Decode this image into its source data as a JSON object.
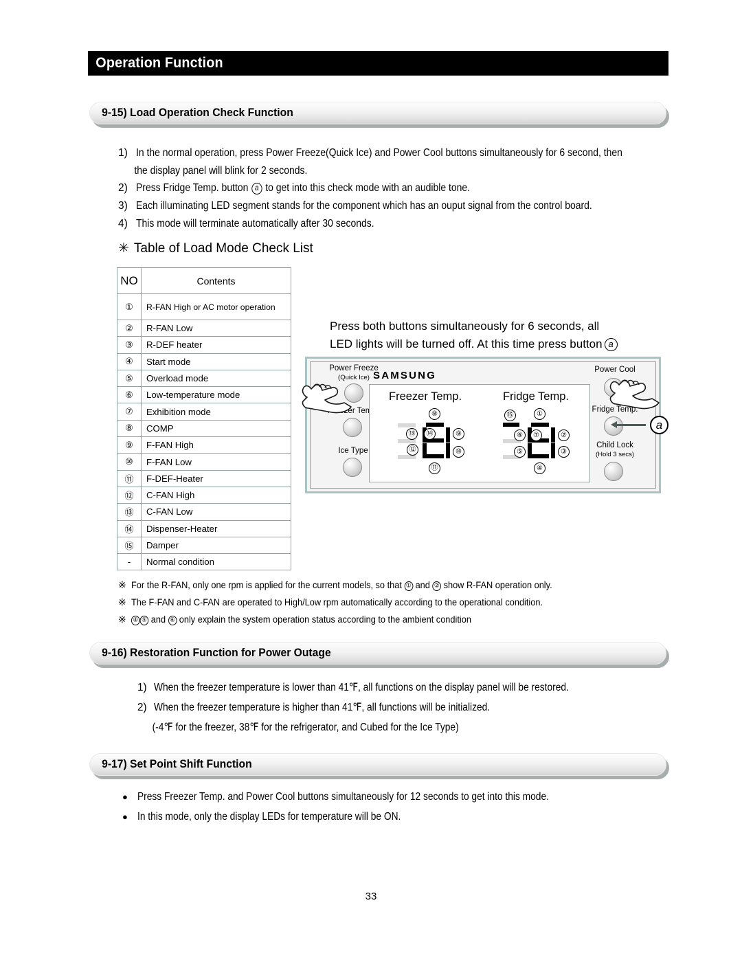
{
  "header": {
    "title": "Operation Function"
  },
  "sections": {
    "s915": {
      "heading": "9-15) Load Operation Check Function"
    },
    "s916": {
      "heading": "9-16) Restoration Function for Power Outage"
    },
    "s917": {
      "heading": "9-17) Set Point Shift Function"
    }
  },
  "steps_915": [
    {
      "marker": "1)",
      "text": "In the normal operation, press Power Freeze(Quick Ice) and Power Cool buttons simultaneously for 6 second, then",
      "cont": "the display panel will blink for 2 seconds."
    },
    {
      "marker": "2)",
      "pre": "Press Fridge Temp. button ",
      "circled": "a",
      "post": " to get into this check mode with an audible tone."
    },
    {
      "marker": "3)",
      "text": "Each illuminating LED segment stands for the component which has an ouput signal from the control board."
    },
    {
      "marker": "4)",
      "text": "This mode will terminate automatically after 30 seconds."
    }
  ],
  "table": {
    "asterisk": "✳",
    "caption": "Table of Load Mode Check List",
    "headers": {
      "no": "NO",
      "contents": "Contents"
    },
    "rows": [
      {
        "no": "①",
        "contents": "R-FAN High or AC motor operation"
      },
      {
        "no": "②",
        "contents": "R-FAN Low"
      },
      {
        "no": "③",
        "contents": "R-DEF heater"
      },
      {
        "no": "④",
        "contents": "Start mode"
      },
      {
        "no": "⑤",
        "contents": "Overload mode"
      },
      {
        "no": "⑥",
        "contents": "Low-temperature mode"
      },
      {
        "no": "⑦",
        "contents": "Exhibition mode"
      },
      {
        "no": "⑧",
        "contents": "COMP"
      },
      {
        "no": "⑨",
        "contents": "F-FAN High"
      },
      {
        "no": "⑩",
        "contents": "F-FAN Low"
      },
      {
        "no": "⑪",
        "contents": "F-DEF-Heater"
      },
      {
        "no": "⑫",
        "contents": "C-FAN High"
      },
      {
        "no": "⑬",
        "contents": "C-FAN Low"
      },
      {
        "no": "⑭",
        "contents": "Dispenser-Heater"
      },
      {
        "no": "⑮",
        "contents": "Damper"
      },
      {
        "no": "-",
        "contents": "Normal condition"
      }
    ]
  },
  "panel": {
    "instruction_line1": "Press both buttons simultaneously for 6 seconds, all",
    "instruction_line2_pre": "LED lights will be turned off.  At this time press button",
    "instruction_circled": "a",
    "brand": "SAMSUNG",
    "freezer_label": "Freezer Temp.",
    "fridge_label": "Fridge Temp.",
    "callout_letter": "a",
    "buttons_left": [
      {
        "label": "Power Freeze",
        "sub": "(Quick Ice)"
      },
      {
        "label": "Freezer Temp.",
        "sub": ""
      },
      {
        "label": "Ice Type",
        "sub": ""
      }
    ],
    "buttons_right": [
      {
        "label": "Power Cool",
        "sub": ""
      },
      {
        "label": "Fridge Temp.",
        "sub": ""
      },
      {
        "label": "Child Lock",
        "sub": "(Hold 3 secs)"
      }
    ],
    "freezer_segments": [
      {
        "num": "⑧",
        "pos": "top"
      },
      {
        "num": "⑬",
        "pos": "upper-left-outer"
      },
      {
        "num": "⑭",
        "pos": "upper-left-inner"
      },
      {
        "num": "⑨",
        "pos": "upper-right"
      },
      {
        "num": "⑫",
        "pos": "lower-left"
      },
      {
        "num": "⑩",
        "pos": "lower-right"
      },
      {
        "num": "⑪",
        "pos": "bottom"
      }
    ],
    "fridge_segments": [
      {
        "num": "⑮",
        "pos": "ghost-top"
      },
      {
        "num": "①",
        "pos": "top"
      },
      {
        "num": "⑥",
        "pos": "upper-left-outer"
      },
      {
        "num": "⑦",
        "pos": "upper-left-inner"
      },
      {
        "num": "②",
        "pos": "upper-right"
      },
      {
        "num": "⑤",
        "pos": "lower-left"
      },
      {
        "num": "③",
        "pos": "lower-right"
      },
      {
        "num": "④",
        "pos": "bottom"
      }
    ]
  },
  "footnotes": [
    {
      "mark": "※",
      "pre": "For the R-FAN, only one rpm is applied for the current models, so that ",
      "c1": "①",
      "mid": " and ",
      "c2": "②",
      "post": " show R-FAN operation only."
    },
    {
      "mark": "※",
      "text": "The F-FAN and C-FAN are operated to High/Low rpm automatically according to the operational condition."
    },
    {
      "mark": "※",
      "c1": "④",
      "c2": "⑤",
      "mid": " and ",
      "c3": "⑥",
      "post": "  only explain the system operation status according to the ambient condition"
    }
  ],
  "steps_916": [
    {
      "marker": "1)",
      "text": "When the freezer temperature is lower than 41℉, all functions on the display panel will be restored."
    },
    {
      "marker": "2)",
      "text": "When the freezer temperature is higher than 41℉, all functions will be initialized.",
      "cont": "(-4℉ for the freezer,  38℉  for the refrigerator, and Cubed for the Ice Type)"
    }
  ],
  "steps_917": [
    {
      "bullet": "●",
      "text": "Press  Freezer Temp. and Power Cool buttons simultaneously for 12 seconds to get into this mode."
    },
    {
      "bullet": "●",
      "text": "In this mode, only the display LEDs for temperature will be ON."
    }
  ],
  "page_number": "33"
}
